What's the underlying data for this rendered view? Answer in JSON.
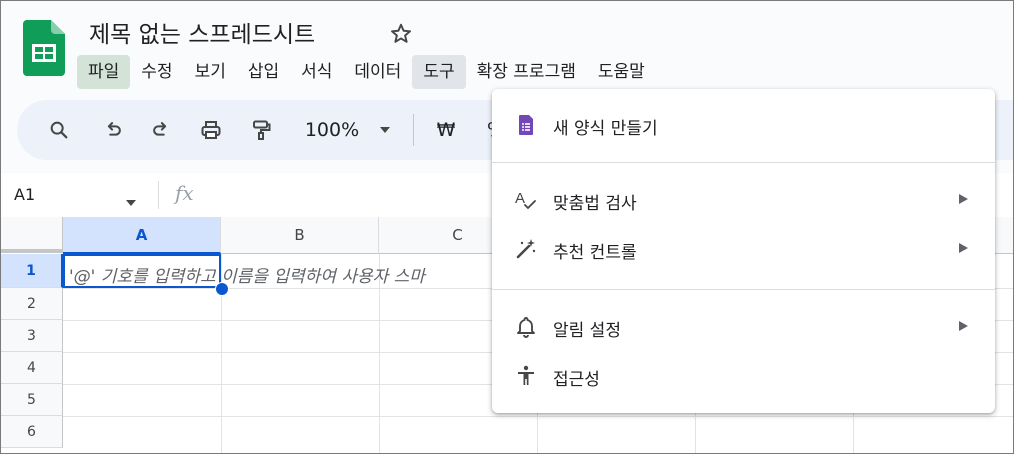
{
  "doc": {
    "title": "제목 없는 스프레드시트"
  },
  "menu": [
    {
      "label": "파일"
    },
    {
      "label": "수정"
    },
    {
      "label": "보기"
    },
    {
      "label": "삽입"
    },
    {
      "label": "서식"
    },
    {
      "label": "데이터"
    },
    {
      "label": "도구"
    },
    {
      "label": "확장 프로그램"
    },
    {
      "label": "도움말"
    }
  ],
  "toolbar": {
    "zoom": "100%",
    "currency": "₩",
    "percent": "%"
  },
  "formula_bar": {
    "name_box": "A1",
    "fx": "fx"
  },
  "grid": {
    "columns": [
      "A",
      "B",
      "C"
    ],
    "rows": [
      "1",
      "2",
      "3",
      "4",
      "5",
      "6"
    ],
    "placeholder": "'@' 기호를 입력하고 이름을 입력하여 사용자 스마"
  },
  "tools_menu": {
    "items": [
      {
        "label": "새 양식 만들기",
        "icon": "forms-icon"
      },
      {
        "label": "맞춤법 검사",
        "icon": "spellcheck-icon"
      },
      {
        "label": "추천 컨트롤",
        "icon": "magic-wand-icon"
      },
      {
        "label": "알림 설정",
        "icon": "bell-icon"
      },
      {
        "label": "접근성",
        "icon": "accessibility-icon"
      }
    ]
  },
  "colors": {
    "brand_green": "#0f9d58",
    "selection_blue": "#0b57d0",
    "forms_purple": "#7248b9"
  }
}
